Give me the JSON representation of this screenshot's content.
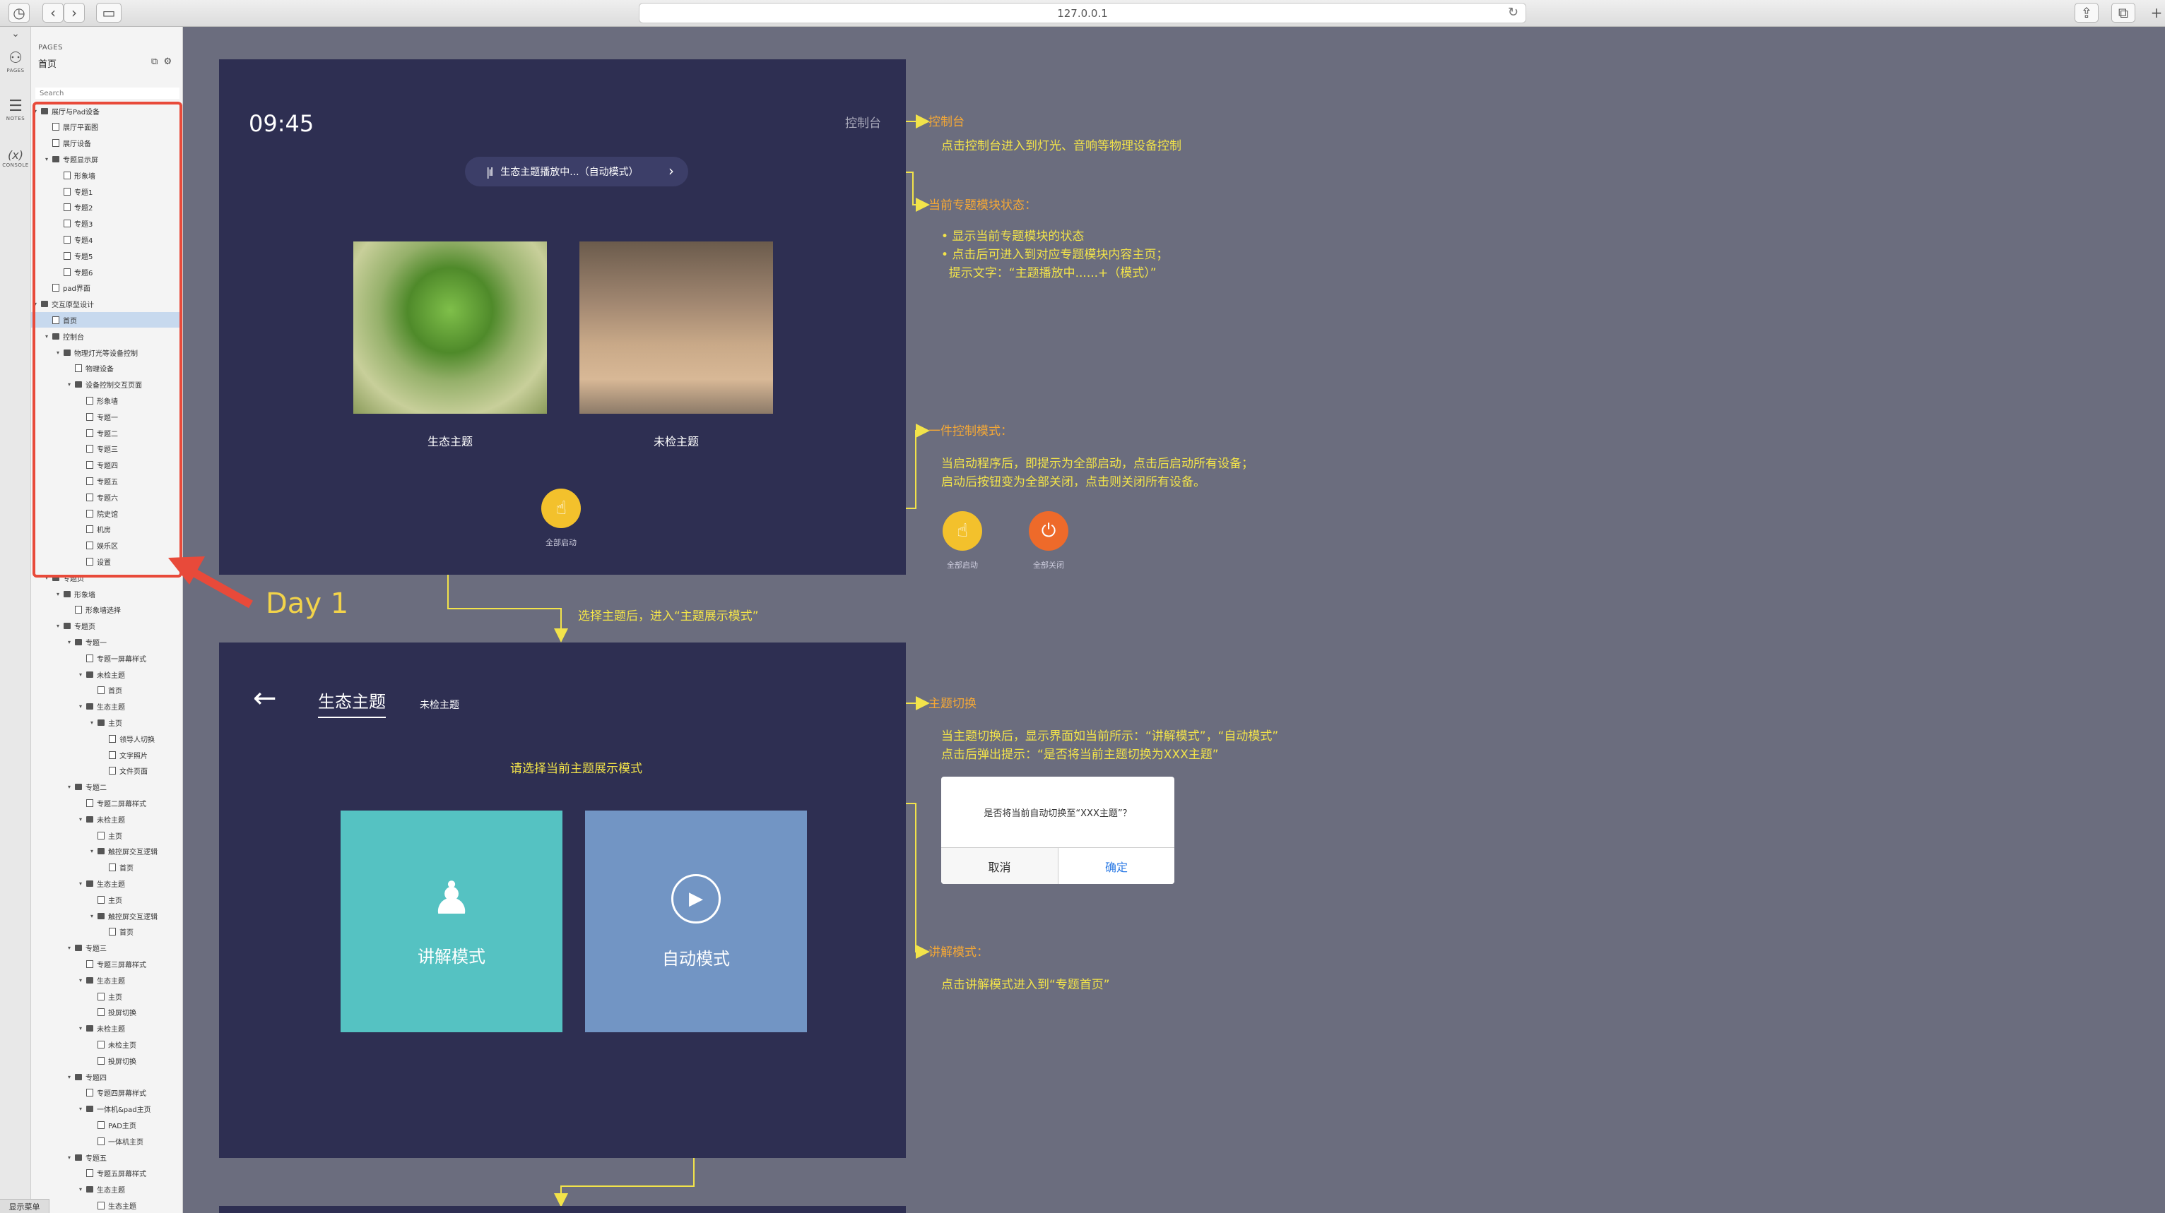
{
  "browser": {
    "url": "127.0.0.1"
  },
  "rail": {
    "pages_label": "PAGES",
    "notes_label": "NOTES",
    "console_label": "CONSOLE",
    "console_glyph": "(x)"
  },
  "panel": {
    "title": "PAGES",
    "current_page": "首页",
    "search_placeholder": "Search",
    "show_menu": "显示菜单",
    "tree": [
      {
        "label": "展厅与Pad设备",
        "depth": 0,
        "type": "folder"
      },
      {
        "label": "展厅平面图",
        "depth": 1,
        "type": "page"
      },
      {
        "label": "展厅设备",
        "depth": 1,
        "type": "page"
      },
      {
        "label": "专题显示屏",
        "depth": 1,
        "type": "folder"
      },
      {
        "label": "形象墙",
        "depth": 2,
        "type": "page"
      },
      {
        "label": "专题1",
        "depth": 2,
        "type": "page"
      },
      {
        "label": "专题2",
        "depth": 2,
        "type": "page"
      },
      {
        "label": "专题3",
        "depth": 2,
        "type": "page"
      },
      {
        "label": "专题4",
        "depth": 2,
        "type": "page"
      },
      {
        "label": "专题5",
        "depth": 2,
        "type": "page"
      },
      {
        "label": "专题6",
        "depth": 2,
        "type": "page"
      },
      {
        "label": "pad界面",
        "depth": 1,
        "type": "page"
      },
      {
        "label": "交互原型设计",
        "depth": 0,
        "type": "folder"
      },
      {
        "label": "首页",
        "depth": 1,
        "type": "page",
        "selected": true
      },
      {
        "label": "控制台",
        "depth": 1,
        "type": "folder"
      },
      {
        "label": "物理灯光等设备控制",
        "depth": 2,
        "type": "folder"
      },
      {
        "label": "物理设备",
        "depth": 3,
        "type": "page"
      },
      {
        "label": "设备控制交互页面",
        "depth": 3,
        "type": "folder"
      },
      {
        "label": "形象墙",
        "depth": 4,
        "type": "page"
      },
      {
        "label": "专题一",
        "depth": 4,
        "type": "page"
      },
      {
        "label": "专题二",
        "depth": 4,
        "type": "page"
      },
      {
        "label": "专题三",
        "depth": 4,
        "type": "page"
      },
      {
        "label": "专题四",
        "depth": 4,
        "type": "page"
      },
      {
        "label": "专题五",
        "depth": 4,
        "type": "page"
      },
      {
        "label": "专题六",
        "depth": 4,
        "type": "page"
      },
      {
        "label": "院史馆",
        "depth": 4,
        "type": "page"
      },
      {
        "label": "机房",
        "depth": 4,
        "type": "page"
      },
      {
        "label": "娱乐区",
        "depth": 4,
        "type": "page"
      },
      {
        "label": "设置",
        "depth": 4,
        "type": "page"
      },
      {
        "label": "专题页",
        "depth": 1,
        "type": "folder"
      },
      {
        "label": "形象墙",
        "depth": 2,
        "type": "folder"
      },
      {
        "label": "形象墙选择",
        "depth": 3,
        "type": "page"
      },
      {
        "label": "专题页",
        "depth": 2,
        "type": "folder"
      },
      {
        "label": "专题一",
        "depth": 3,
        "type": "folder"
      },
      {
        "label": "专题一屏幕样式",
        "depth": 4,
        "type": "page"
      },
      {
        "label": "未检主题",
        "depth": 4,
        "type": "folder"
      },
      {
        "label": "首页",
        "depth": 5,
        "type": "page"
      },
      {
        "label": "生态主题",
        "depth": 4,
        "type": "folder"
      },
      {
        "label": "主页",
        "depth": 5,
        "type": "folder"
      },
      {
        "label": "领导人切换",
        "depth": 6,
        "type": "page"
      },
      {
        "label": "文字照片",
        "depth": 6,
        "type": "page"
      },
      {
        "label": "文件页面",
        "depth": 6,
        "type": "page"
      },
      {
        "label": "专题二",
        "depth": 3,
        "type": "folder"
      },
      {
        "label": "专题二屏幕样式",
        "depth": 4,
        "type": "page"
      },
      {
        "label": "未检主题",
        "depth": 4,
        "type": "folder"
      },
      {
        "label": "主页",
        "depth": 5,
        "type": "page"
      },
      {
        "label": "触控屏交互逻辑",
        "depth": 5,
        "type": "folder"
      },
      {
        "label": "首页",
        "depth": 6,
        "type": "page"
      },
      {
        "label": "生态主题",
        "depth": 4,
        "type": "folder"
      },
      {
        "label": "主页",
        "depth": 5,
        "type": "page"
      },
      {
        "label": "触控屏交互逻辑",
        "depth": 5,
        "type": "folder"
      },
      {
        "label": "首页",
        "depth": 6,
        "type": "page"
      },
      {
        "label": "专题三",
        "depth": 3,
        "type": "folder"
      },
      {
        "label": "专题三屏幕样式",
        "depth": 4,
        "type": "page"
      },
      {
        "label": "生态主题",
        "depth": 4,
        "type": "folder"
      },
      {
        "label": "主页",
        "depth": 5,
        "type": "page"
      },
      {
        "label": "投屏切换",
        "depth": 5,
        "type": "page"
      },
      {
        "label": "未检主题",
        "depth": 4,
        "type": "folder"
      },
      {
        "label": "未检主页",
        "depth": 5,
        "type": "page"
      },
      {
        "label": "投屏切换",
        "depth": 5,
        "type": "page"
      },
      {
        "label": "专题四",
        "depth": 3,
        "type": "folder"
      },
      {
        "label": "专题四屏幕样式",
        "depth": 4,
        "type": "page"
      },
      {
        "label": "一体机&pad主页",
        "depth": 4,
        "type": "folder"
      },
      {
        "label": "PAD主页",
        "depth": 5,
        "type": "page"
      },
      {
        "label": "一体机主页",
        "depth": 5,
        "type": "page"
      },
      {
        "label": "专题五",
        "depth": 3,
        "type": "folder"
      },
      {
        "label": "专题五屏幕样式",
        "depth": 4,
        "type": "page"
      },
      {
        "label": "生态主题",
        "depth": 4,
        "type": "folder"
      },
      {
        "label": "生态主题",
        "depth": 5,
        "type": "page"
      }
    ]
  },
  "callout": {
    "day_label": "Day 1"
  },
  "screen1": {
    "time": "09:45",
    "console_label": "控制台",
    "status": "生态主题播放中...（自动模式）",
    "themes": [
      {
        "label": "生态主题"
      },
      {
        "label": "未检主题"
      }
    ],
    "start_all_label": "全部启动"
  },
  "screen2": {
    "active_tab": "生态主题",
    "other_tab": "未检主题",
    "prompt": "请选择当前主题展示模式",
    "mode_teach": "讲解模式",
    "mode_auto": "自动模式"
  },
  "annotations": {
    "console_title": "控制台",
    "console_desc": "点击控制台进入到灯光、音响等物理设备控制",
    "status_title": "当前专题模块状态：",
    "status_lines": [
      "• 显示当前专题模块的状态",
      "• 点击后可进入到对应专题模块内容主页；",
      "  提示文字：“主题播放中......+（模式）”"
    ],
    "onekey_title": "一件控制模式：",
    "onekey_lines": [
      "当启动程序后，即提示为全部启动，点击后启动所有设备；",
      "启动后按钮变为全部关闭，点击则关闭所有设备。"
    ],
    "start_all": "全部启动",
    "stop_all": "全部关闭",
    "select_theme": "选择主题后，进入“主题展示模式”",
    "switch_title": "主题切换",
    "switch_lines": [
      "当主题切换后，显示界面如当前所示：“讲解模式”，“自动模式”",
      "点击后弹出提示：“是否将当前主题切换为XXX主题”"
    ],
    "dialog_text": "是否将当前自动切换至“XXX主题”？",
    "dialog_cancel": "取消",
    "dialog_ok": "确定",
    "teach_title": "讲解模式：",
    "teach_desc": "点击讲解模式进入到“专题首页”"
  },
  "colors": {
    "screen_bg": "#2e2f52",
    "canvas_bg": "#6b6d7e",
    "annotation_yellow": "#f2e34a",
    "annotation_orange": "#f5a836",
    "callout_red": "#e84a3a"
  }
}
